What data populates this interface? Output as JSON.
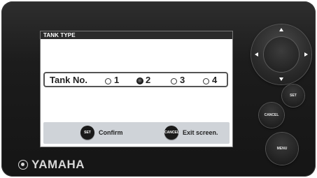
{
  "screen": {
    "title": "TANK TYPE",
    "tank_label": "Tank No.",
    "options": [
      {
        "label": "1",
        "selected": false
      },
      {
        "label": "2",
        "selected": true
      },
      {
        "label": "3",
        "selected": false
      },
      {
        "label": "4",
        "selected": false
      }
    ]
  },
  "footer": {
    "set_icon": "SET",
    "set_label": "Confirm",
    "cancel_icon": "CANCEL",
    "cancel_label": "Exit screen."
  },
  "device": {
    "brand": "YAMAHA",
    "buttons": {
      "set": "SET",
      "cancel": "CANCEL",
      "menu": "MENU"
    },
    "dpad_icons": [
      "arrow-up-icon",
      "arrow-down-icon",
      "arrow-left-icon",
      "arrow-right-icon"
    ]
  },
  "colors": {
    "bezel": "#1c1c1c",
    "title_bar": "#2b2b2b",
    "footer_bg": "#cfd3d8"
  }
}
